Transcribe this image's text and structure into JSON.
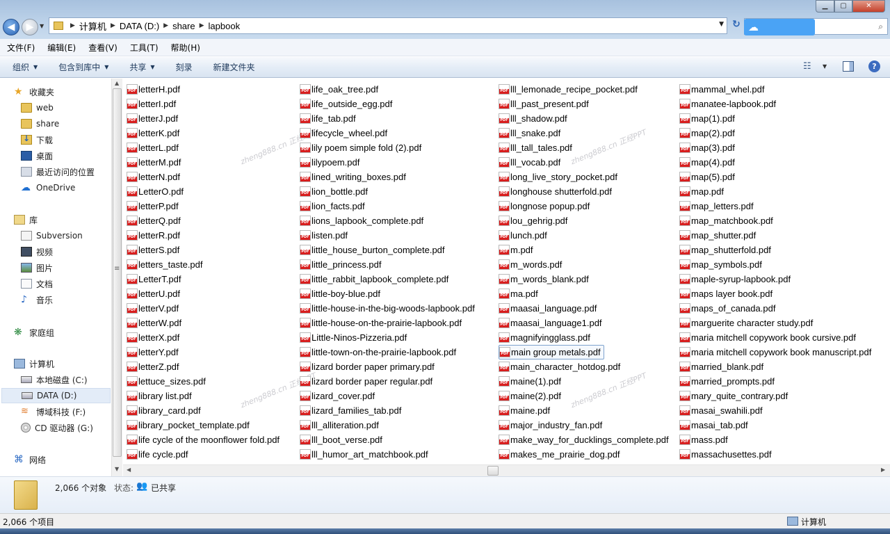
{
  "address": {
    "crumbs": [
      "计算机",
      "DATA (D:)",
      "share",
      "lapbook"
    ]
  },
  "menu": [
    "文件(F)",
    "编辑(E)",
    "查看(V)",
    "工具(T)",
    "帮助(H)"
  ],
  "commands": [
    {
      "label": "组织",
      "dropdown": true
    },
    {
      "label": "包含到库中",
      "dropdown": true
    },
    {
      "label": "共享",
      "dropdown": true
    },
    {
      "label": "刻录",
      "dropdown": false
    },
    {
      "label": "新建文件夹",
      "dropdown": false
    }
  ],
  "nav": {
    "favorites": {
      "label": "收藏夹",
      "items": [
        "web",
        "share",
        "下载",
        "桌面",
        "最近访问的位置",
        "OneDrive"
      ]
    },
    "libraries": {
      "label": "库",
      "items": [
        "Subversion",
        "视频",
        "图片",
        "文档",
        "音乐"
      ]
    },
    "homegroup": "家庭组",
    "computer": {
      "label": "计算机",
      "items": [
        "本地磁盘 (C:)",
        "DATA (D:)",
        "博域科技 (F:)",
        "CD 驱动器 (G:)"
      ],
      "selected": "DATA (D:)"
    },
    "network": "网络"
  },
  "files": {
    "columns": [
      [
        "letterH.pdf",
        "letterI.pdf",
        "letterJ.pdf",
        "letterK.pdf",
        "letterL.pdf",
        "letterM.pdf",
        "letterN.pdf",
        "LetterO.pdf",
        "letterP.pdf",
        "letterQ.pdf",
        "letterR.pdf",
        "letterS.pdf",
        "letters_taste.pdf",
        "LetterT.pdf",
        "letterU.pdf",
        "letterV.pdf",
        "letterW.pdf",
        "letterX.pdf",
        "letterY.pdf",
        "letterZ.pdf",
        "lettuce_sizes.pdf",
        "library list.pdf",
        "library_card.pdf",
        "library_pocket_template.pdf",
        "life cycle of the moonflower fold.pdf",
        "life cycle.pdf"
      ],
      [
        "life_oak_tree.pdf",
        "life_outside_egg.pdf",
        "life_tab.pdf",
        "lifecycle_wheel.pdf",
        "lily poem simple fold (2).pdf",
        "lilypoem.pdf",
        "lined_writing_boxes.pdf",
        "lion_bottle.pdf",
        "lion_facts.pdf",
        "lions_lapbook_complete.pdf",
        "listen.pdf",
        "little_house_burton_complete.pdf",
        "little_princess.pdf",
        "little_rabbit_lapbook_complete.pdf",
        "little-boy-blue.pdf",
        "little-house-in-the-big-woods-lapbook.pdf",
        "little-house-on-the-prairie-lapbook.pdf",
        "Little-Ninos-Pizzeria.pdf",
        "little-town-on-the-prairie-lapbook.pdf",
        "lizard border paper primary.pdf",
        "lizard border paper regular.pdf",
        "lizard_cover.pdf",
        "lizard_families_tab.pdf",
        "lll_alliteration.pdf",
        "lll_boot_verse.pdf",
        "lll_humor_art_matchbook.pdf"
      ],
      [
        "lll_lemonade_recipe_pocket.pdf",
        "lll_past_present.pdf",
        "lll_shadow.pdf",
        "lll_snake.pdf",
        "lll_tall_tales.pdf",
        "lll_vocab.pdf",
        "long_live_story_pocket.pdf",
        "longhouse shutterfold.pdf",
        "longnose popup.pdf",
        "lou_gehrig.pdf",
        "lunch.pdf",
        "m.pdf",
        "m_words.pdf",
        "m_words_blank.pdf",
        "ma.pdf",
        "maasai_language.pdf",
        "maasai_language1.pdf",
        "magnifyingglass.pdf",
        "main group metals.pdf",
        "main_character_hotdog.pdf",
        "maine(1).pdf",
        "maine(2).pdf",
        "maine.pdf",
        "major_industry_fan.pdf",
        "make_way_for_ducklings_complete.pdf",
        "makes_me_prairie_dog.pdf"
      ],
      [
        "mammal_whel.pdf",
        "manatee-lapbook.pdf",
        "map(1).pdf",
        "map(2).pdf",
        "map(3).pdf",
        "map(4).pdf",
        "map(5).pdf",
        "map.pdf",
        "map_letters.pdf",
        "map_matchbook.pdf",
        "map_shutter.pdf",
        "map_shutterfold.pdf",
        "map_symbols.pdf",
        "maple-syrup-lapbook.pdf",
        "maps layer book.pdf",
        "maps_of_canada.pdf",
        "marguerite character study.pdf",
        "maria mitchell copywork book cursive.pdf",
        "maria mitchell copywork book manuscript.pdf",
        "married_blank.pdf",
        "married_prompts.pdf",
        "mary_quite_contrary.pdf",
        "masai_swahili.pdf",
        "masai_tab.pdf",
        "mass.pdf",
        "massachusettes.pdf"
      ]
    ],
    "hovered": "main group metals.pdf"
  },
  "watermark": "zheng888.cn 正经PPT",
  "details": {
    "count": "2,066 个对象",
    "state_label": "状态:",
    "state": "已共享"
  },
  "status": {
    "items": "2,066 个项目",
    "location": "计算机"
  }
}
